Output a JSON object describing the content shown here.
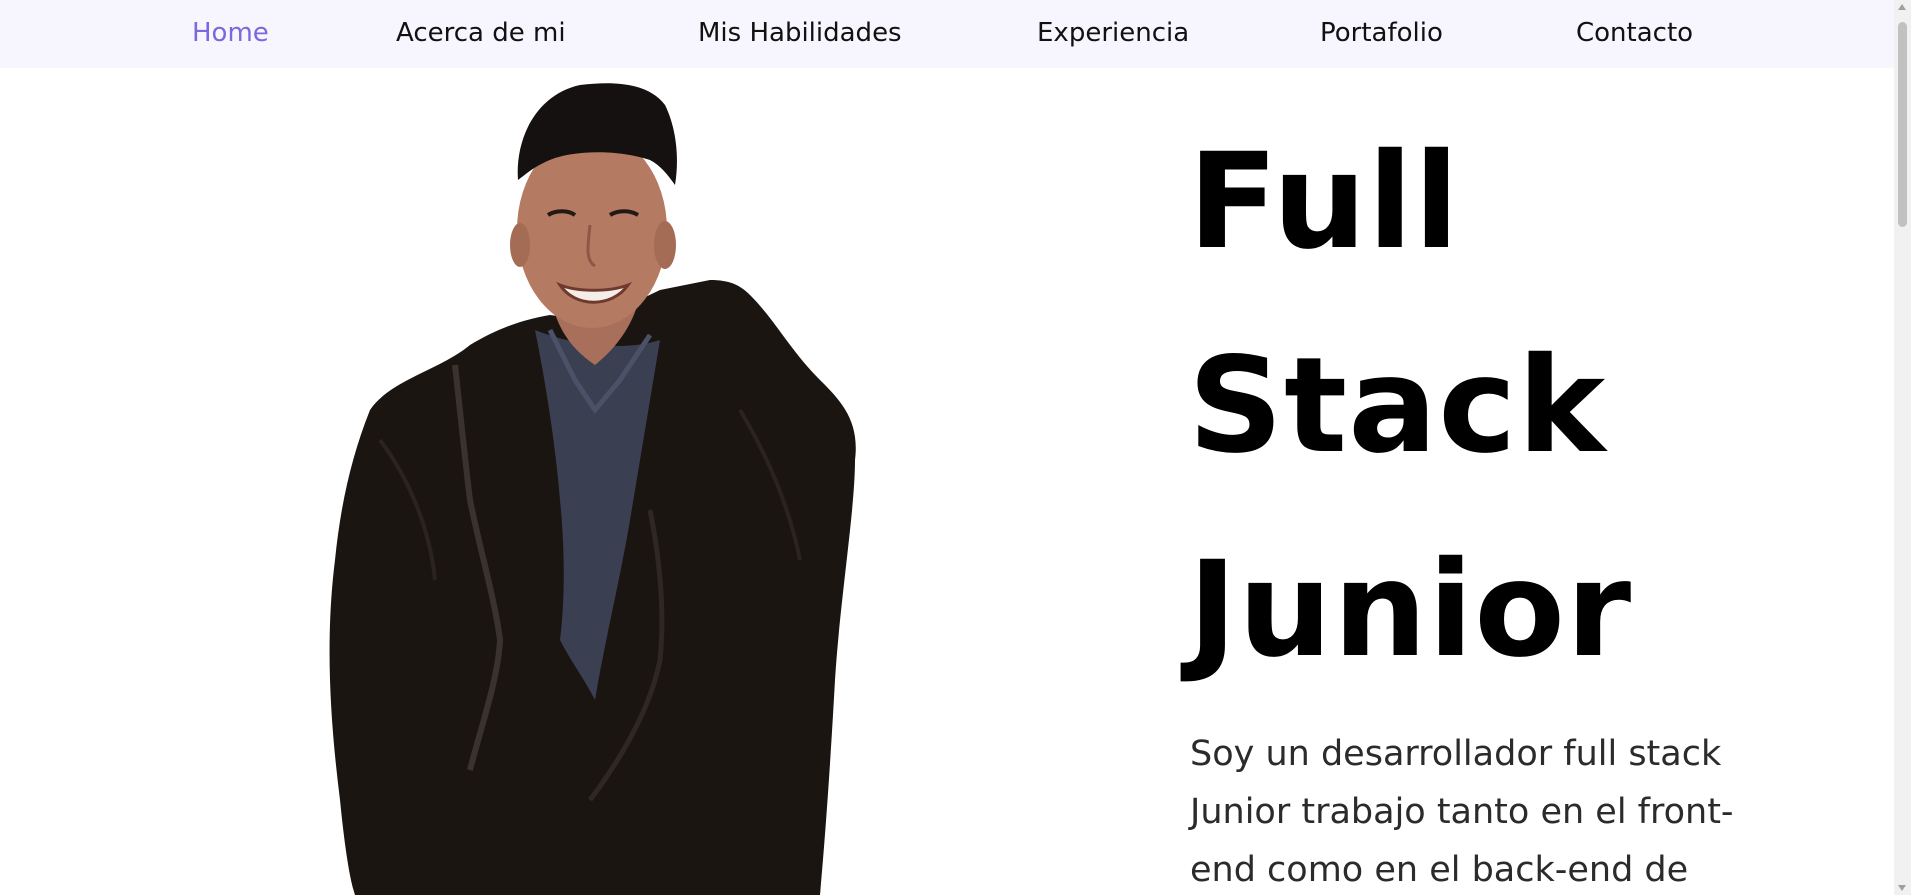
{
  "nav": {
    "items": [
      {
        "label": "Home",
        "active": true
      },
      {
        "label": "Acerca de mi",
        "active": false
      },
      {
        "label": "Mis Habilidades",
        "active": false
      },
      {
        "label": "Experiencia",
        "active": false
      },
      {
        "label": "Portafolio",
        "active": false
      },
      {
        "label": "Contacto",
        "active": false
      }
    ]
  },
  "hero": {
    "title_lines": [
      "Full",
      "Stack",
      "Junior"
    ],
    "description": "Soy un desarrollador full stack Junior trabajo tanto en el front-end como en el back-end de"
  },
  "colors": {
    "accent": "#7a68dc",
    "nav_background": "#f7f5fe",
    "text": "#111111"
  }
}
